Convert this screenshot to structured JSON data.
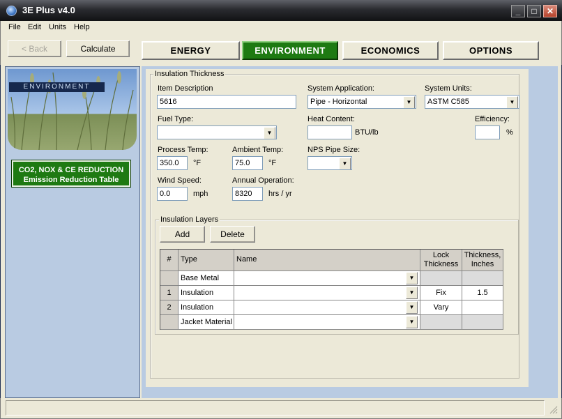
{
  "window": {
    "title": "3E Plus v4.0",
    "minimize": "_",
    "maximize": "□",
    "close": "✕"
  },
  "menu": [
    "File",
    "Edit",
    "Units",
    "Help"
  ],
  "toolbar": {
    "back": "< Back",
    "calculate": "Calculate"
  },
  "tabs": [
    {
      "label": "ENERGY",
      "active": false
    },
    {
      "label": "ENVIRONMENT",
      "active": true
    },
    {
      "label": "ECONOMICS",
      "active": false
    },
    {
      "label": "OPTIONS",
      "active": false
    }
  ],
  "sidebar": {
    "banner_label": "ENVIRONMENT",
    "report_button": {
      "line1": "CO2, NOX & CE REDUCTION",
      "line2": "Emission Reduction Table"
    }
  },
  "form": {
    "group_title": "Insulation Thickness",
    "item_description": {
      "label": "Item Description",
      "value": "5616"
    },
    "system_application": {
      "label": "System Application:",
      "value": "Pipe - Horizontal"
    },
    "system_units": {
      "label": "System Units:",
      "value": "ASTM C585"
    },
    "fuel_type": {
      "label": "Fuel Type:",
      "value": ""
    },
    "heat_content": {
      "label": "Heat Content:",
      "value": "",
      "unit": "BTU/lb"
    },
    "efficiency": {
      "label": "Efficiency:",
      "value": "",
      "unit": "%"
    },
    "process_temp": {
      "label": "Process Temp:",
      "value": "350.0",
      "unit": "°F"
    },
    "ambient_temp": {
      "label": "Ambient Temp:",
      "value": "75.0",
      "unit": "°F"
    },
    "nps_pipe_size": {
      "label": "NPS Pipe Size:",
      "value": ""
    },
    "wind_speed": {
      "label": "Wind Speed:",
      "value": "0.0",
      "unit": "mph"
    },
    "annual_operation": {
      "label": "Annual Operation:",
      "value": "8320",
      "unit": "hrs / yr"
    }
  },
  "layers": {
    "group_title": "Insulation Layers",
    "add": "Add",
    "delete": "Delete",
    "columns": [
      "#",
      "Type",
      "Name",
      "Lock Thickness",
      "Thickness, Inches"
    ],
    "col_lock_1": "Lock",
    "col_lock_2": "Thickness",
    "col_thick_1": "Thickness,",
    "col_thick_2": "Inches",
    "rows": [
      {
        "num": "",
        "type": "Base Metal",
        "name": "",
        "lock": "",
        "thickness": ""
      },
      {
        "num": "1",
        "type": "Insulation",
        "name": "",
        "lock": "Fix",
        "thickness": "1.5"
      },
      {
        "num": "2",
        "type": "Insulation",
        "name": "",
        "lock": "Vary",
        "thickness": ""
      },
      {
        "num": "",
        "type": "Jacket Material",
        "name": "",
        "lock": "",
        "thickness": ""
      }
    ]
  },
  "colors": {
    "accent_green": "#1e7a12",
    "panel_blue": "#b9cbe2",
    "dialog": "#ece9d8"
  }
}
